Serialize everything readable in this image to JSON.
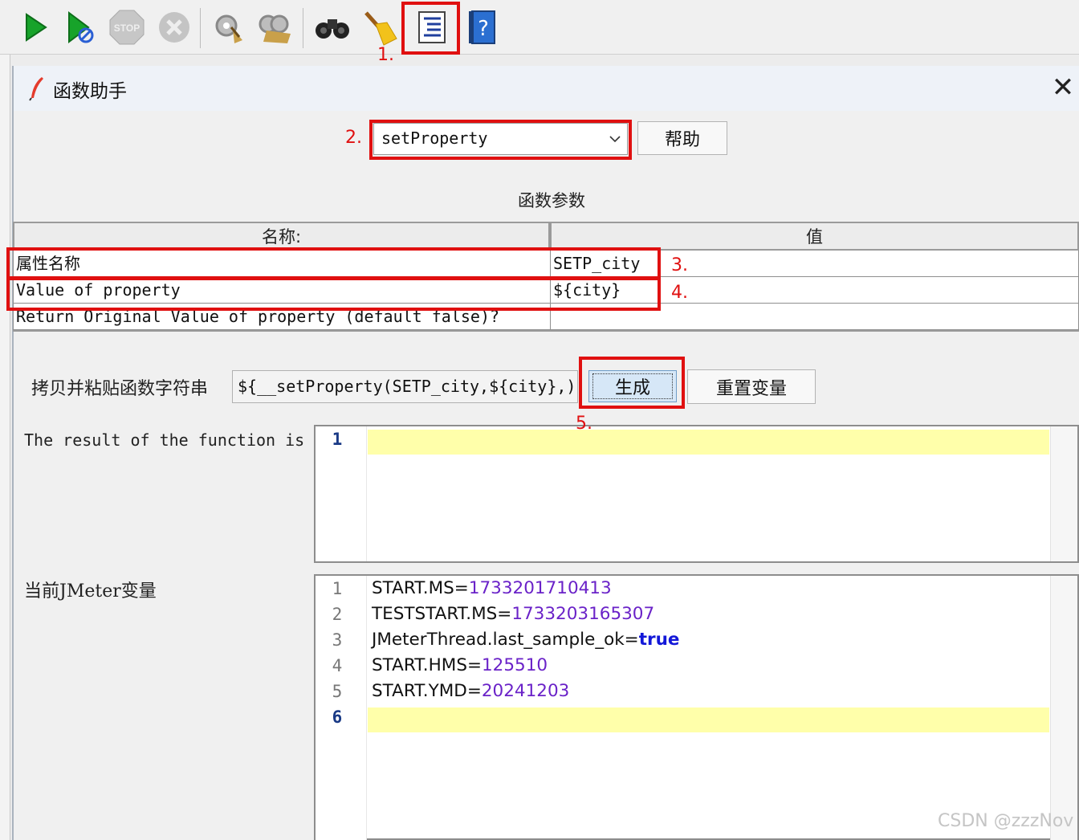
{
  "toolbar": {
    "buttons": [
      {
        "name": "start-icon",
        "label": "Start"
      },
      {
        "name": "start-no-pause-icon",
        "label": "Start no pauses"
      },
      {
        "name": "stop-icon",
        "label": "STOP"
      },
      {
        "name": "shutdown-icon",
        "label": "Shutdown"
      },
      {
        "name": "clear-icon",
        "label": "Clear"
      },
      {
        "name": "clear-all-icon",
        "label": "Clear All"
      },
      {
        "name": "search-binoculars-icon",
        "label": "Search"
      },
      {
        "name": "reset-search-broom-icon",
        "label": "Reset Search"
      },
      {
        "name": "function-helper-icon",
        "label": "Function Helper Dialog"
      },
      {
        "name": "help-book-icon",
        "label": "Help"
      }
    ],
    "stop_text": "STOP"
  },
  "dialog": {
    "title": "函数助手",
    "close_glyph": "✕",
    "function_select": {
      "value": "setProperty"
    },
    "help_button": "帮助",
    "params_label": "函数参数",
    "table": {
      "headers": [
        "名称:",
        "值"
      ],
      "rows": [
        {
          "name": "属性名称",
          "value": "SETP_city"
        },
        {
          "name": "Value of property",
          "value": "${city}"
        },
        {
          "name": "Return Original Value of property (default false)?",
          "value": ""
        }
      ]
    },
    "copy_label": "拷贝并粘贴函数字符串",
    "copy_value": "${__setProperty(SETP_city,${city},)}",
    "generate_button": "生成",
    "reset_button": "重置变量",
    "result_label": "The result of the function is",
    "result_lines": [
      "1"
    ],
    "vars_label": "当前JMeter变量",
    "vars_editor": {
      "line_numbers": [
        "1",
        "2",
        "3",
        "4",
        "5",
        "6"
      ],
      "lines": [
        {
          "key": "START.MS=",
          "value": "1733201710413"
        },
        {
          "key": "TESTSTART.MS=",
          "value": "1733203165307"
        },
        {
          "key": "JMeterThread.last_sample_ok=",
          "value": "true"
        },
        {
          "key": "START.HMS=",
          "value": "125510"
        },
        {
          "key": "START.YMD=",
          "value": "20241203"
        }
      ]
    }
  },
  "annotations": [
    "1.",
    "2.",
    "3.",
    "4.",
    "5."
  ],
  "watermark": "CSDN @zzzNov",
  "colors": {
    "annotation_red": "#e01010",
    "number_purple": "#6a22c8",
    "keyword_blue": "#1318d8",
    "current_line": "#ffffaa"
  }
}
